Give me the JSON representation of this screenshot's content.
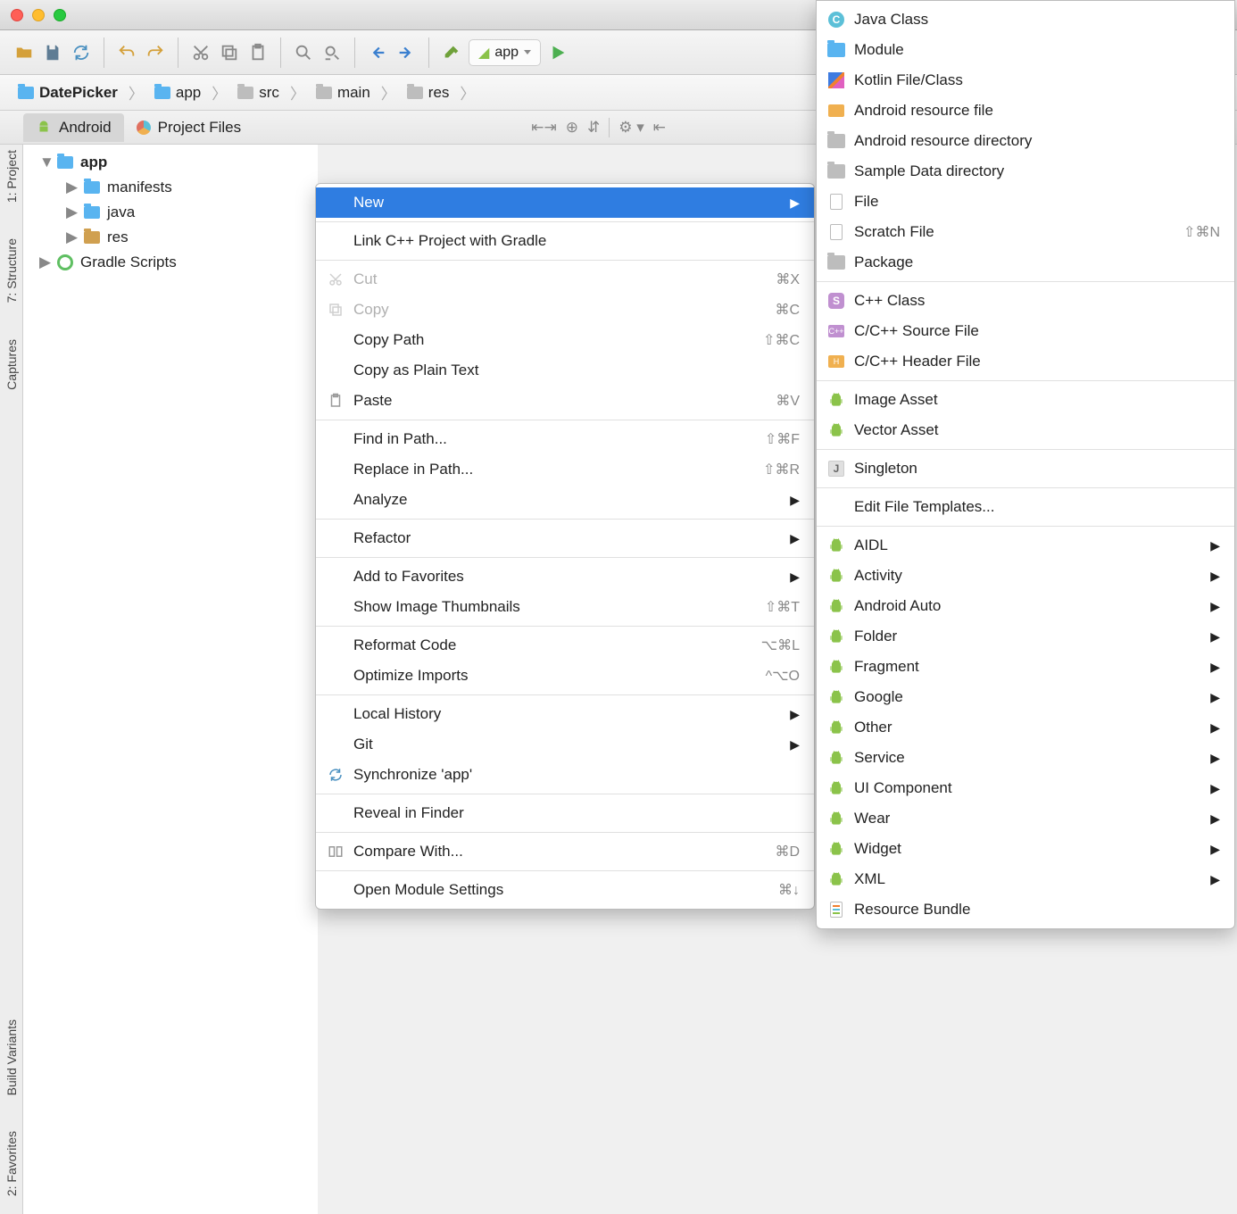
{
  "toolbar": {
    "app_chip": "app"
  },
  "breadcrumb": [
    "DatePicker",
    "app",
    "src",
    "main",
    "res"
  ],
  "tool_window_tabs": {
    "tab1": "Android",
    "tab2": "Project Files"
  },
  "left_rail": [
    {
      "label": "1: Project"
    },
    {
      "label": "7: Structure"
    },
    {
      "label": "Captures"
    },
    {
      "label": "Build Variants"
    },
    {
      "label": "2: Favorites"
    }
  ],
  "tree": {
    "root": "app",
    "children": [
      "manifests",
      "java",
      "res"
    ],
    "gradle": "Gradle Scripts"
  },
  "context_menu": [
    {
      "label": "New",
      "submenu": true,
      "selected": true
    },
    {
      "sep": true
    },
    {
      "label": "Link C++ Project with Gradle"
    },
    {
      "sep": true
    },
    {
      "label": "Cut",
      "shortcut": "⌘X",
      "icon": "cut",
      "disabled": true
    },
    {
      "label": "Copy",
      "shortcut": "⌘C",
      "icon": "copy",
      "disabled": true
    },
    {
      "label": "Copy Path",
      "shortcut": "⇧⌘C"
    },
    {
      "label": "Copy as Plain Text"
    },
    {
      "label": "Paste",
      "shortcut": "⌘V",
      "icon": "paste"
    },
    {
      "sep": true
    },
    {
      "label": "Find in Path...",
      "shortcut": "⇧⌘F"
    },
    {
      "label": "Replace in Path...",
      "shortcut": "⇧⌘R"
    },
    {
      "label": "Analyze",
      "submenu": true
    },
    {
      "sep": true
    },
    {
      "label": "Refactor",
      "submenu": true
    },
    {
      "sep": true
    },
    {
      "label": "Add to Favorites",
      "submenu": true
    },
    {
      "label": "Show Image Thumbnails",
      "shortcut": "⇧⌘T"
    },
    {
      "sep": true
    },
    {
      "label": "Reformat Code",
      "shortcut": "⌥⌘L"
    },
    {
      "label": "Optimize Imports",
      "shortcut": "^⌥O"
    },
    {
      "sep": true
    },
    {
      "label": "Local History",
      "submenu": true
    },
    {
      "label": "Git",
      "submenu": true
    },
    {
      "label": "Synchronize 'app'",
      "icon": "sync"
    },
    {
      "sep": true
    },
    {
      "label": "Reveal in Finder"
    },
    {
      "sep": true
    },
    {
      "label": "Compare With...",
      "shortcut": "⌘D",
      "icon": "compare"
    },
    {
      "sep": true
    },
    {
      "label": "Open Module Settings",
      "shortcut": "⌘↓"
    }
  ],
  "new_submenu": [
    {
      "label": "Java Class",
      "icon": "class-c"
    },
    {
      "label": "Module",
      "icon": "folder-blue"
    },
    {
      "label": "Kotlin File/Class",
      "icon": "kotlin"
    },
    {
      "label": "Android resource file",
      "icon": "xml"
    },
    {
      "label": "Android resource directory",
      "icon": "folder"
    },
    {
      "label": "Sample Data directory",
      "icon": "folder"
    },
    {
      "label": "File",
      "icon": "file"
    },
    {
      "label": "Scratch File",
      "icon": "file",
      "shortcut": "⇧⌘N"
    },
    {
      "label": "Package",
      "icon": "folder"
    },
    {
      "sep": true
    },
    {
      "label": "C++ Class",
      "icon": "square-s"
    },
    {
      "label": "C/C++ Source File",
      "icon": "cpp"
    },
    {
      "label": "C/C++ Header File",
      "icon": "cpp-h"
    },
    {
      "sep": true
    },
    {
      "label": "Image Asset",
      "icon": "android"
    },
    {
      "label": "Vector Asset",
      "icon": "android"
    },
    {
      "sep": true
    },
    {
      "label": "Singleton",
      "icon": "square-j"
    },
    {
      "sep": true
    },
    {
      "label": "Edit File Templates..."
    },
    {
      "sep": true
    },
    {
      "label": "AIDL",
      "icon": "android",
      "submenu": true
    },
    {
      "label": "Activity",
      "icon": "android",
      "submenu": true
    },
    {
      "label": "Android Auto",
      "icon": "android",
      "submenu": true
    },
    {
      "label": "Folder",
      "icon": "android",
      "submenu": true
    },
    {
      "label": "Fragment",
      "icon": "android",
      "submenu": true
    },
    {
      "label": "Google",
      "icon": "android",
      "submenu": true
    },
    {
      "label": "Other",
      "icon": "android",
      "submenu": true
    },
    {
      "label": "Service",
      "icon": "android",
      "submenu": true
    },
    {
      "label": "UI Component",
      "icon": "android",
      "submenu": true
    },
    {
      "label": "Wear",
      "icon": "android",
      "submenu": true
    },
    {
      "label": "Widget",
      "icon": "android",
      "submenu": true
    },
    {
      "label": "XML",
      "icon": "android",
      "submenu": true
    },
    {
      "label": "Resource Bundle",
      "icon": "properties"
    }
  ]
}
